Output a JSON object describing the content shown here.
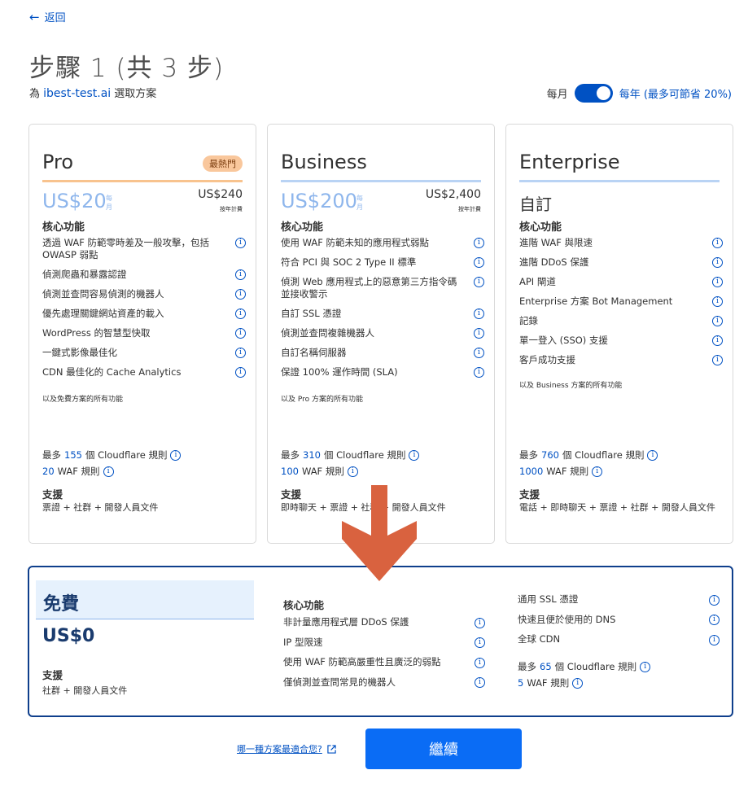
{
  "nav": {
    "back_label": "返回"
  },
  "header": {
    "step_title": "步驟 1 (共 3 步)",
    "subtitle_prefix": "為 ",
    "domain": "ibest-test.ai",
    "subtitle_suffix": " 選取方案"
  },
  "billing": {
    "monthly_label": "每月",
    "yearly_label": "每年 (最多可節省 20%)",
    "yearly_selected": true
  },
  "plans": [
    {
      "name": "Pro",
      "badge": "最熱門",
      "price": "US$20",
      "price_unit": "每月",
      "annual_price": "US$240",
      "annual_note": "按年計費",
      "core_label": "核心功能",
      "features": [
        "透過 WAF 防範零時差及一般攻擊，包括 OWASP 弱點",
        "偵測爬蟲和暴露認證",
        "偵測並查問容易偵測的機器人",
        "優先處理關鍵網站資產的載入",
        "WordPress 的智慧型快取",
        "一鍵式影像最佳化",
        "CDN 最佳化的 Cache Analytics"
      ],
      "also": "以及免費方案的所有功能",
      "rules_prefix": "最多 ",
      "rules_num": "155",
      "rules_suffix": " 個 Cloudflare 規則",
      "waf_num": "20",
      "waf_suffix": " WAF 規則",
      "support_label": "支援",
      "support": "票證 + 社群 + 開發人員文件"
    },
    {
      "name": "Business",
      "price": "US$200",
      "price_unit": "每月",
      "annual_price": "US$2,400",
      "annual_note": "按年計費",
      "core_label": "核心功能",
      "features": [
        "使用 WAF 防範未知的應用程式弱點",
        "符合 PCI 與 SOC 2 Type II 標準",
        "偵測 Web 應用程式上的惡意第三方指令碼並接收警示",
        "自訂 SSL 憑證",
        "偵測並查問複雜機器人",
        "自訂名稱伺服器",
        "保證 100% 運作時間 (SLA)"
      ],
      "also": "以及 Pro 方案的所有功能",
      "rules_prefix": "最多 ",
      "rules_num": "310",
      "rules_suffix": " 個 Cloudflare 規則",
      "waf_num": "100",
      "waf_suffix": " WAF 規則",
      "support_label": "支援",
      "support": "即時聊天 + 票證 + 社群 + 開發人員文件"
    },
    {
      "name": "Enterprise",
      "price": "自訂",
      "core_label": "核心功能",
      "features": [
        "進階 WAF 與限速",
        "進階 DDoS 保護",
        "API 閘道",
        "Enterprise 方案 Bot Management",
        "記錄",
        "單一登入 (SSO) 支援",
        "客戶成功支援"
      ],
      "also": "以及 Business 方案的所有功能",
      "rules_prefix": "最多 ",
      "rules_num": "760",
      "rules_suffix": " 個 Cloudflare 規則",
      "waf_num": "1000",
      "waf_suffix": " WAF 規則",
      "support_label": "支援",
      "support": "電話 + 即時聊天 + 票證 + 社群 + 開發人員文件"
    }
  ],
  "free_plan": {
    "name": "免費",
    "price": "US$0",
    "support_label": "支援",
    "support": "社群 + 開發人員文件",
    "core_label": "核心功能",
    "features_col1": [
      "非計量應用程式層 DDoS 保護",
      "IP 型限速",
      "使用 WAF 防範高嚴重性且廣泛的弱點",
      "僅偵測並查問常見的機器人"
    ],
    "features_col2": [
      "通用 SSL 憑證",
      "快速且便於使用的 DNS",
      "全球 CDN"
    ],
    "rules_prefix": "最多 ",
    "rules_num": "65",
    "rules_suffix": " 個 Cloudflare 規則",
    "waf_num": "5",
    "waf_suffix": " WAF 規則"
  },
  "footer": {
    "help_link": "哪一種方案最適合您?",
    "continue_label": "繼續"
  },
  "colors": {
    "accent": "#0051c3",
    "button": "#0a6cf5",
    "arrow": "#d9623f",
    "pro_bar": "#f8c38e",
    "plan_bar": "#b9d3f4"
  },
  "icons": {
    "back": "arrow-left-icon",
    "info": "info-icon",
    "external": "external-link-icon"
  }
}
